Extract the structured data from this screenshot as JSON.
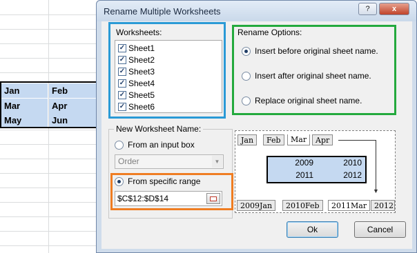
{
  "spreadsheet": {
    "cells": [
      [
        "Jan",
        "Feb"
      ],
      [
        "Mar",
        "Apr"
      ],
      [
        "May",
        "Jun"
      ]
    ]
  },
  "dialog": {
    "title": "Rename Multiple Worksheets",
    "help_label": "?",
    "close_label": "x",
    "worksheets": {
      "label": "Worksheets:",
      "items": [
        {
          "name": "Sheet1",
          "checked": true
        },
        {
          "name": "Sheet2",
          "checked": true
        },
        {
          "name": "Sheet3",
          "checked": true
        },
        {
          "name": "Sheet4",
          "checked": true
        },
        {
          "name": "Sheet5",
          "checked": true
        },
        {
          "name": "Sheet6",
          "checked": true
        }
      ]
    },
    "rename_options": {
      "label": "Rename Options:",
      "options": [
        {
          "label": "Insert before original sheet name.",
          "selected": true
        },
        {
          "label": "Insert after original sheet name.",
          "selected": false
        },
        {
          "label": "Replace original sheet name.",
          "selected": false
        }
      ]
    },
    "new_name": {
      "label": "New Worksheet Name:",
      "from_input_label": "From an input box",
      "order_placeholder": "Order",
      "from_range_label": "From specific range",
      "range_value": "$C$12:$D$14"
    },
    "preview": {
      "top_tabs": [
        "Jan",
        "Feb",
        "Mar",
        "Apr"
      ],
      "grid": [
        [
          "2009",
          "2010"
        ],
        [
          "2011",
          "2012"
        ]
      ],
      "bottom_tabs": [
        "2009Jan",
        "2010Feb",
        "2011Mar",
        "2012"
      ]
    },
    "ok_label": "Ok",
    "cancel_label": "Cancel"
  },
  "colors": {
    "worksheets_highlight": "#2a9ad6",
    "options_highlight": "#23a93d",
    "range_highlight": "#ef7d22",
    "selection_fill": "#c5d9f1"
  }
}
